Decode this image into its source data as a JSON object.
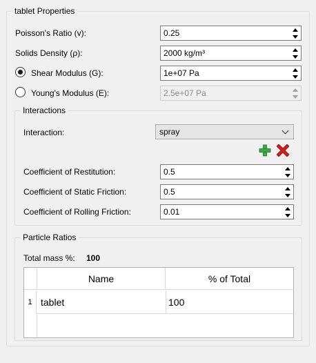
{
  "properties": {
    "title": "tablet Properties",
    "poisson": {
      "label": "Poisson's Ratio (v):",
      "value": "0.25"
    },
    "density": {
      "label": "Solids Density (ρ):",
      "value": "2000 kg/m³"
    },
    "shear": {
      "label": "Shear Modulus (G):",
      "value": "1e+07 Pa",
      "selected": true
    },
    "young": {
      "label": "Young's Modulus (E):",
      "value": "2.5e+07 Pa",
      "selected": false
    }
  },
  "interactions": {
    "title": "Interactions",
    "interaction_label": "Interaction:",
    "interaction_value": "spray",
    "add_icon": "plus-icon",
    "remove_icon": "x-icon",
    "restitution": {
      "label": "Coefficient of Restitution:",
      "value": "0.5"
    },
    "static_friction": {
      "label": "Coefficient of Static Friction:",
      "value": "0.5"
    },
    "rolling_friction": {
      "label": "Coefficient of Rolling Friction:",
      "value": "0.01"
    }
  },
  "particle_ratios": {
    "title": "Particle Ratios",
    "total_label": "Total mass %:",
    "total_value": "100",
    "columns": [
      "Name",
      "% of Total"
    ],
    "rows": [
      {
        "index": "1",
        "name": "tablet",
        "percent": "100"
      }
    ]
  },
  "colors": {
    "add_green": "#3aa845",
    "remove_red": "#d11f1f"
  }
}
